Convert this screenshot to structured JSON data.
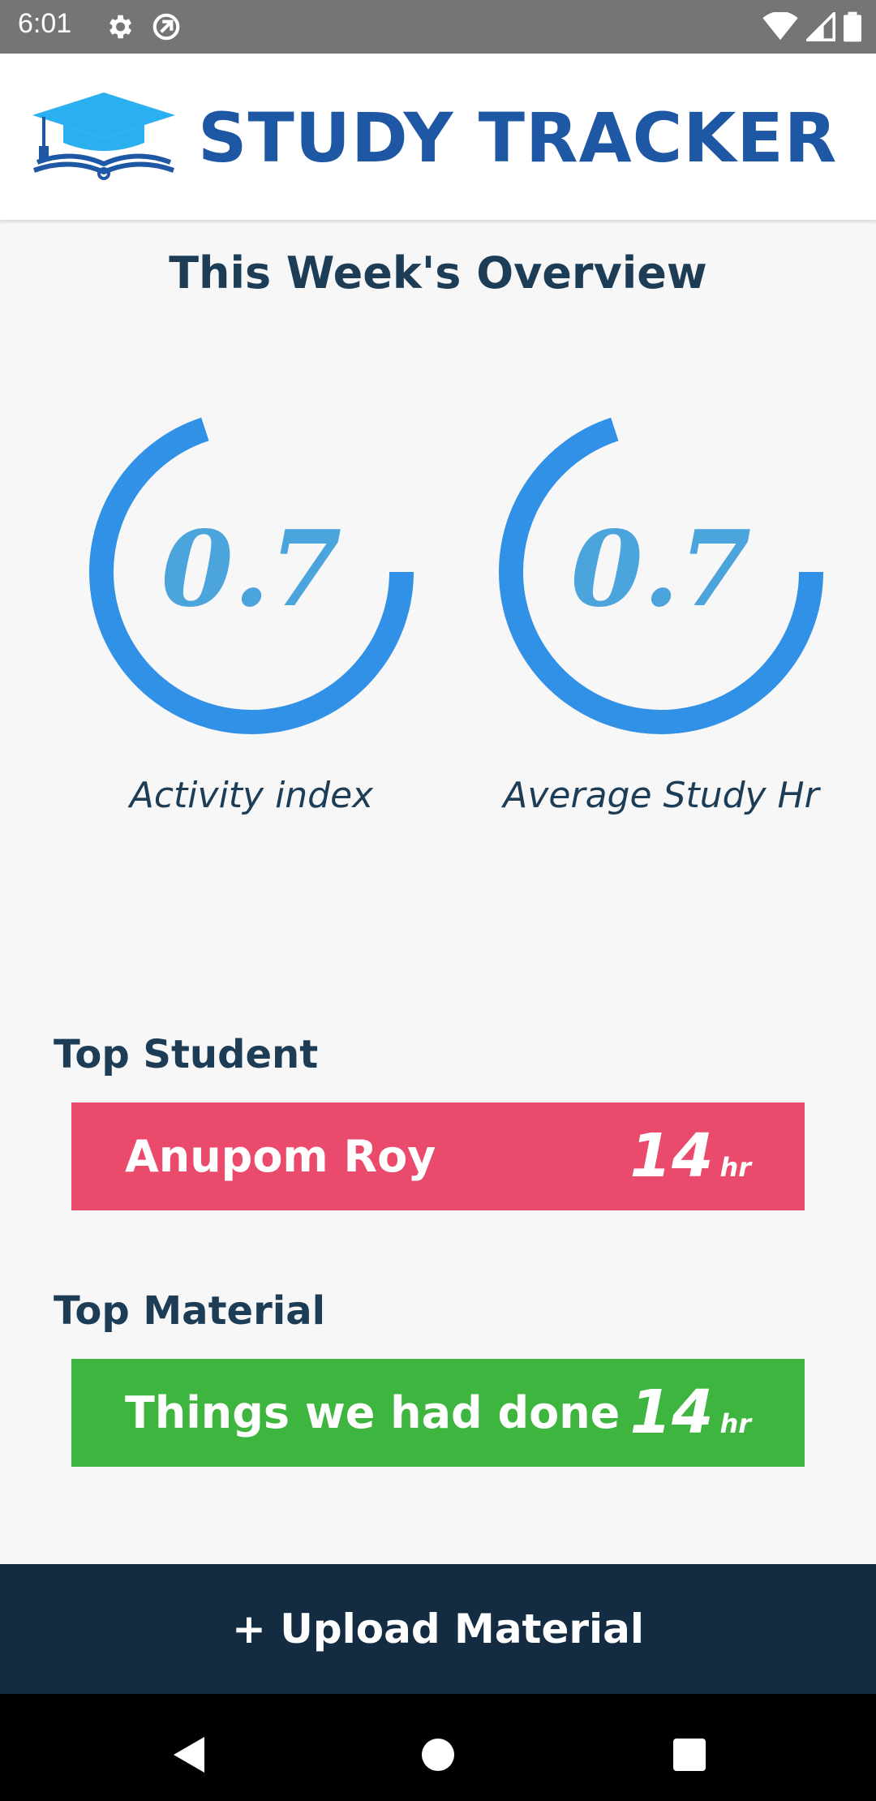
{
  "status_bar": {
    "time": "6:01",
    "icons": [
      "settings-icon",
      "sync-icon",
      "wifi-icon",
      "signal-icon",
      "battery-icon"
    ]
  },
  "header": {
    "logo_icon": "graduation-cap-book-icon",
    "title": "STUDY TRACKER",
    "brand_color": "#1e57a3",
    "accent_color": "#2ab0f0"
  },
  "overview": {
    "title": "This Week's Overview",
    "gauges": [
      {
        "value": "0.7",
        "label": "Activity index",
        "progress": 0.7
      },
      {
        "value": "0.7",
        "label": "Average Study Hr",
        "progress": 0.7
      }
    ],
    "gauge_color": "#3191e6"
  },
  "top_student": {
    "section_title": "Top Student",
    "name": "Anupom Roy",
    "hours": "14",
    "unit": "hr",
    "color": "#ea4a6b"
  },
  "top_material": {
    "section_title": "Top Material",
    "name": "Things we had done",
    "hours": "14",
    "unit": "hr",
    "color": "#3db53e"
  },
  "upload_button": {
    "label": "+ Upload Material",
    "color": "#132c42"
  },
  "nav": {
    "items": [
      "back-icon",
      "home-icon",
      "recents-icon"
    ]
  }
}
